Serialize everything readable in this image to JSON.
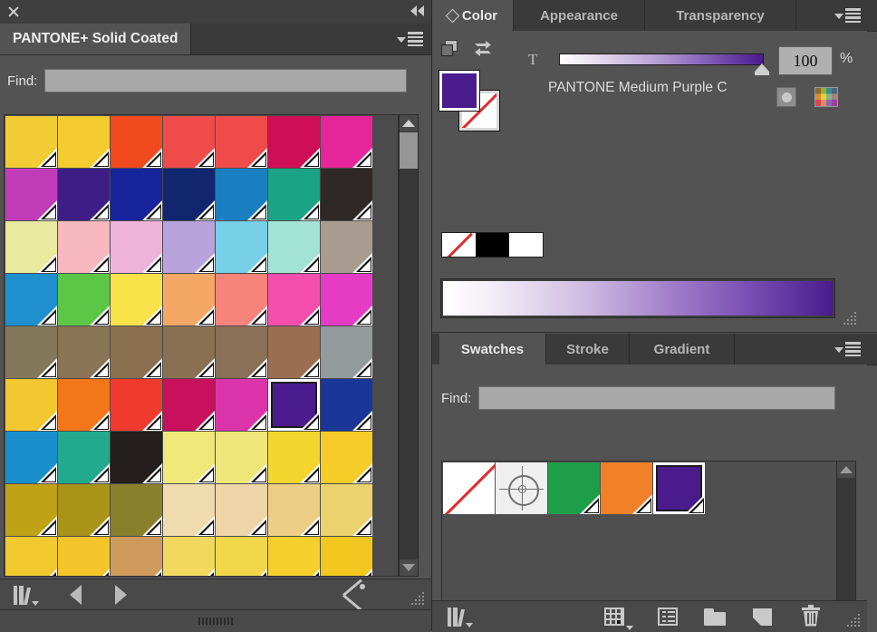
{
  "left_panel": {
    "titlebar": {
      "close_icon": "close-icon",
      "collapse_icon": "double-chevron-left-icon"
    },
    "library_tab": "PANTONE+ Solid Coated",
    "panel_menu_icon": "panel-menu-icon",
    "find": {
      "label": "Find:",
      "value": "",
      "placeholder": ""
    },
    "grid": {
      "columns": 7,
      "selected_index": 40,
      "swatches": [
        "#f2cc35",
        "#f5cc2f",
        "#f04a1e",
        "#f04b4b",
        "#f04b4b",
        "#cf0f55",
        "#e6259b",
        "#c13cb8",
        "#3d1e87",
        "#17239b",
        "#11266e",
        "#1a7fc1",
        "#1aa384",
        "#2e2926",
        "#e8ea9e",
        "#f7b8c0",
        "#f0b4dc",
        "#b9a3dd",
        "#77cfe8",
        "#a3e3d4",
        "#a89c91",
        "#1f8fce",
        "#5cc747",
        "#f7e24a",
        "#f5a866",
        "#f7847a",
        "#f54fae",
        "#e63bc4",
        "#83785a",
        "#8a7456",
        "#8a7050",
        "#8a7052",
        "#8a7057",
        "#9b6e52",
        "#939a9a",
        "#f2c72f",
        "#f4761a",
        "#f03a2e",
        "#c8105c",
        "#dc35ab",
        "#4a1b8c",
        "#1b3699",
        "#1a8ecb",
        "#23a98d",
        "#241f1c",
        "#f0e97a",
        "#f0e77a",
        "#f5d62e",
        "#f5cc28",
        "#bfa215",
        "#a89419",
        "#8a7f2b",
        "#f0dbae",
        "#eed6a8",
        "#eccf84",
        "#ecd26e",
        "#f2c92f",
        "#f4c52a",
        "#cf9b5c",
        "#f0d95e",
        "#f2d74a",
        "#f5cf2b",
        "#f2c71f"
      ]
    },
    "scrollbar": {
      "up_icon": "scroll-up-arrow-icon",
      "down_icon": "scroll-down-arrow-icon"
    },
    "footer": {
      "library_icon": "swatch-libraries-menu-icon",
      "prev_icon": "load-previous-library-icon",
      "next_icon": "load-next-library-icon",
      "wand_icon": "magic-wand-icon"
    }
  },
  "color_panel": {
    "tabs": [
      {
        "label": "Color",
        "active": true,
        "icon": "diamond-icon"
      },
      {
        "label": "Appearance",
        "active": false
      },
      {
        "label": "Transparency",
        "active": false
      }
    ],
    "panel_menu_icon": "panel-menu-icon",
    "stack_icon": "color-stack-icon",
    "swap_icon": "swap-fill-stroke-icon",
    "fill_color": "#4a1b8c",
    "stroke_color": "none",
    "tint": {
      "label": "T",
      "value": "100",
      "unit": "%",
      "track_from": "#ffffff",
      "track_to": "#4a1b8c"
    },
    "color_name": "PANTONE Medium Purple C",
    "spot_indicator_icon": "spot-color-indicator-icon",
    "gamut_icon": "color-spectrum-thumbnail-icon",
    "quick_swatches": [
      {
        "name": "none-swatch",
        "color": "none"
      },
      {
        "name": "black-swatch",
        "color": "#000000"
      },
      {
        "name": "white-swatch",
        "color": "#ffffff"
      }
    ],
    "spectrum_bar": {
      "from": "#ffffff",
      "to": "#4a1b8c"
    }
  },
  "swatches_panel": {
    "tabs": [
      {
        "label": "Swatches",
        "active": true
      },
      {
        "label": "Stroke",
        "active": false
      },
      {
        "label": "Gradient",
        "active": false
      }
    ],
    "panel_menu_icon": "panel-menu-icon",
    "find": {
      "label": "Find:",
      "value": "",
      "placeholder": ""
    },
    "swatches": [
      {
        "name": "none-swatch",
        "type": "none",
        "color": "#ffffff",
        "selected": false
      },
      {
        "name": "registration-swatch",
        "type": "registration",
        "color": "#efefef",
        "selected": false
      },
      {
        "name": "green-swatch",
        "type": "spot",
        "color": "#1f9e4a",
        "selected": false
      },
      {
        "name": "orange-swatch",
        "type": "spot",
        "color": "#f08128",
        "selected": false
      },
      {
        "name": "purple-swatch",
        "type": "spot",
        "color": "#4a1b8c",
        "selected": true
      }
    ],
    "scrollbar": {
      "up_icon": "scroll-up-arrow-icon",
      "down_icon": "scroll-down-arrow-icon"
    },
    "footer": {
      "library_icon": "swatch-libraries-menu-icon",
      "kinds_icon": "show-swatch-kinds-menu-icon",
      "options_icon": "swatch-options-icon",
      "new_group_icon": "new-color-group-icon",
      "new_swatch_icon": "new-swatch-icon",
      "delete_icon": "delete-swatch-icon"
    }
  }
}
